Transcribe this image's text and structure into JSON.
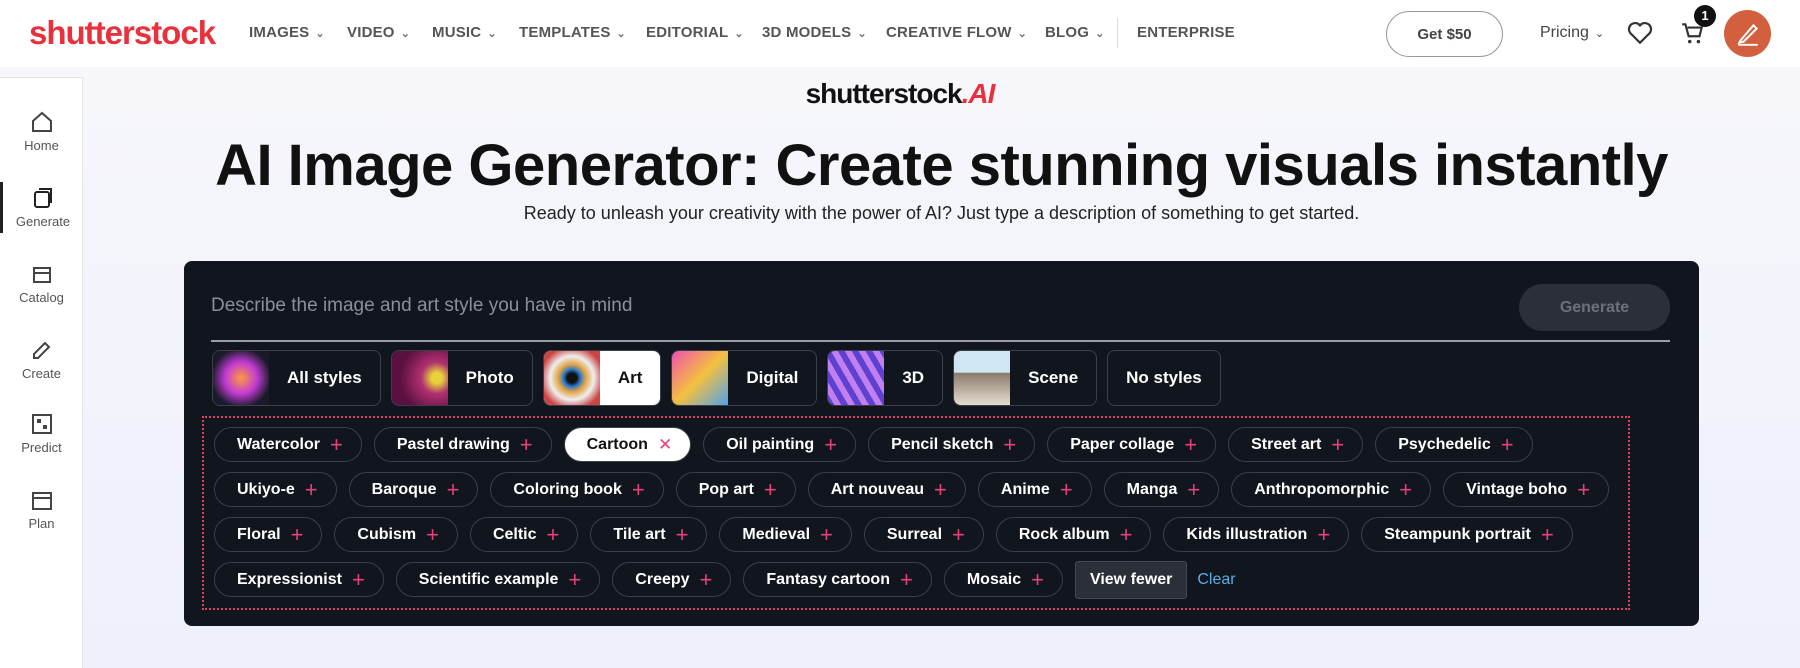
{
  "header": {
    "logo": "shutterstock",
    "nav": [
      "IMAGES",
      "VIDEO",
      "MUSIC",
      "TEMPLATES",
      "EDITORIAL",
      "3D MODELS",
      "CREATIVE FLOW",
      "BLOG"
    ],
    "enterprise": "ENTERPRISE",
    "get50": "Get $50",
    "pricing": "Pricing",
    "cart_count": "1"
  },
  "sidebar": [
    {
      "label": "Home"
    },
    {
      "label": "Generate"
    },
    {
      "label": "Catalog"
    },
    {
      "label": "Create"
    },
    {
      "label": "Predict"
    },
    {
      "label": "Plan"
    }
  ],
  "hero": {
    "ai_logo": "shutterstock",
    "ai_logo_suffix": ".AI",
    "title": "AI Image Generator: Create stunning visuals instantly",
    "subtitle": "Ready to unleash your creativity with the power of AI? Just type a description of something to get started."
  },
  "panel": {
    "placeholder": "Describe the image and art style you have in mind",
    "generate": "Generate",
    "styles": [
      "All styles",
      "Photo",
      "Art",
      "Digital",
      "3D",
      "Scene",
      "No styles"
    ],
    "selected_style": "Art",
    "tag_rows": [
      [
        "Watercolor",
        "Pastel drawing",
        "Cartoon",
        "Oil painting",
        "Pencil sketch",
        "Paper collage",
        "Street art",
        "Psychedelic"
      ],
      [
        "Ukiyo-e",
        "Baroque",
        "Coloring book",
        "Pop art",
        "Art nouveau",
        "Anime",
        "Manga",
        "Anthropomorphic",
        "Vintage boho"
      ],
      [
        "Floral",
        "Cubism",
        "Celtic",
        "Tile art",
        "Medieval",
        "Surreal",
        "Rock album",
        "Kids illustration",
        "Steampunk portrait"
      ],
      [
        "Expressionist",
        "Scientific example",
        "Creepy",
        "Fantasy cartoon",
        "Mosaic"
      ]
    ],
    "selected_tag": "Cartoon",
    "view_fewer": "View fewer",
    "clear": "Clear"
  },
  "colors": {
    "brand": "#e8313c",
    "panel": "#11151e",
    "plus": "#e8407a",
    "link": "#5aaee0"
  }
}
